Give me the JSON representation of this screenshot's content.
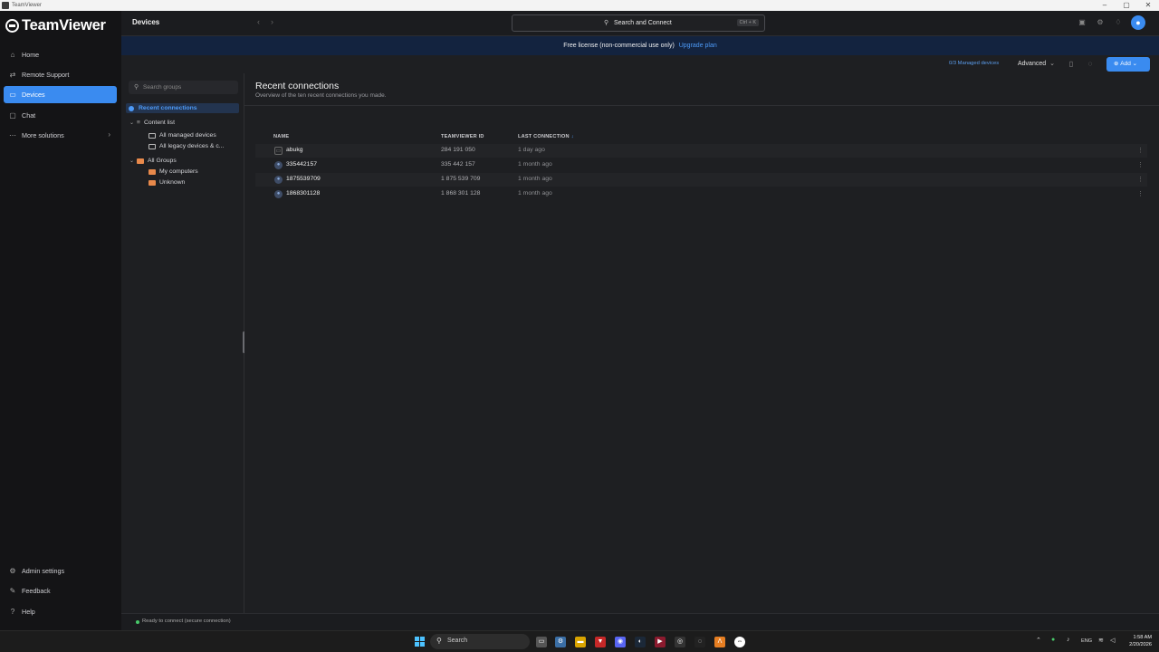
{
  "window": {
    "title": "TeamViewer",
    "minimize": "–",
    "maximize": "▢",
    "close": "✕"
  },
  "brand": {
    "logo_text": "TeamViewer"
  },
  "sidebar": {
    "items": [
      {
        "label": "Home",
        "icon": "home-icon"
      },
      {
        "label": "Remote Support",
        "icon": "remote-support-icon"
      },
      {
        "label": "Devices",
        "icon": "devices-icon",
        "active": true
      },
      {
        "label": "Chat",
        "icon": "chat-icon"
      },
      {
        "label": "More solutions",
        "icon": "more-icon"
      }
    ],
    "bottom_items": [
      {
        "label": "Admin settings",
        "icon": "admin-settings-icon"
      },
      {
        "label": "Feedback",
        "icon": "feedback-icon"
      },
      {
        "label": "Help",
        "icon": "help-icon"
      }
    ]
  },
  "header": {
    "page_title": "Devices",
    "search_label": "Search and Connect",
    "search_shortcut": "Ctrl + K"
  },
  "banner": {
    "text": "Free license (non-commercial use only)",
    "link": "Upgrade plan"
  },
  "toolbar": {
    "managed_devices": "0/3 Managed devices",
    "view_mode": "Advanced",
    "add_label": "Add"
  },
  "groups": {
    "search_placeholder": "Search groups",
    "recent": "Recent connections",
    "content_list": "Content list",
    "all_managed": "All managed devices",
    "all_legacy": "All legacy devices & c...",
    "all_groups": "All Groups",
    "my_computers": "My computers",
    "unknown": "Unknown"
  },
  "main": {
    "title": "Recent connections",
    "subtitle": "Overview of the ten recent connections you made.",
    "columns": {
      "name": "NAME",
      "id": "TEAMVIEWER ID",
      "last": "LAST CONNECTION"
    },
    "rows": [
      {
        "name": "abukg",
        "id": "284 191 050",
        "last": "1 day ago",
        "type": "computer"
      },
      {
        "name": "335442157",
        "id": "335 442 157",
        "last": "1 month ago",
        "type": "user"
      },
      {
        "name": "1875539709",
        "id": "1 875 539 709",
        "last": "1 month ago",
        "type": "user"
      },
      {
        "name": "1868301128",
        "id": "1 868 301 128",
        "last": "1 month ago",
        "type": "user"
      }
    ]
  },
  "status": {
    "text": "Ready to connect (secure connection)"
  },
  "taskbar": {
    "search_label": "Search",
    "lang": "ENG",
    "time": "1:58 AM",
    "date": "2/20/2026"
  },
  "colors": {
    "accent": "#3a8bf0",
    "banner_bg": "#13233f",
    "background": "#1e1f22"
  }
}
